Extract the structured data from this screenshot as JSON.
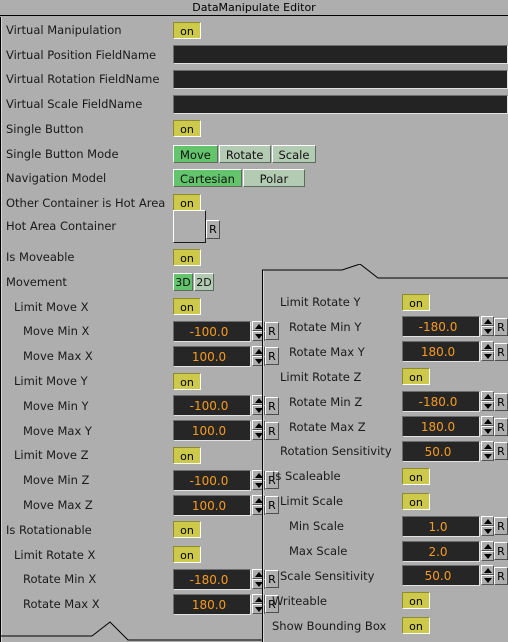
{
  "window": {
    "title": "DataManipulate Editor"
  },
  "colors": {
    "background": "#aeaeae",
    "toggle_on": "#cdc94a",
    "segment_selected": "#63c46c",
    "segment_unselected": "#b4cbb3",
    "field_background": "#262626",
    "field_text": "#f79b20"
  },
  "reset_label": "R",
  "left_column": {
    "rows": [
      {
        "label": "Virtual Manipulation",
        "type": "toggle",
        "value": "on",
        "indent": 0
      },
      {
        "label": "Virtual Position FieldName",
        "type": "text",
        "value": "",
        "indent": 0
      },
      {
        "label": "Virtual Rotation FieldName",
        "type": "text",
        "value": "",
        "indent": 0
      },
      {
        "label": "Virtual Scale FieldName",
        "type": "text",
        "value": "",
        "indent": 0
      },
      {
        "label": "Single Button",
        "type": "toggle",
        "value": "on",
        "indent": 0
      },
      {
        "label": "Single Button Mode",
        "type": "segments",
        "options": [
          "Move",
          "Rotate",
          "Scale"
        ],
        "selected": "Move",
        "indent": 0
      },
      {
        "label": "Navigation Model",
        "type": "segments",
        "options": [
          "Cartesian",
          "Polar"
        ],
        "selected": "Cartesian",
        "indent": 0
      },
      {
        "label": "Other Container is Hot Area",
        "type": "toggle",
        "value": "on",
        "indent": 0
      },
      {
        "label": "Hot Area Container",
        "type": "picker",
        "value": "",
        "indent": 0
      },
      {
        "label": "Is Moveable",
        "type": "toggle",
        "value": "on",
        "indent": 0
      },
      {
        "label": "Movement",
        "type": "segments",
        "options": [
          "3D",
          "2D"
        ],
        "selected": "3D",
        "indent": 0
      },
      {
        "label": "Limit Move X",
        "type": "toggle",
        "value": "on",
        "indent": 1
      },
      {
        "label": "Move Min X",
        "type": "number",
        "value": "-100.0",
        "indent": 2
      },
      {
        "label": "Move Max X",
        "type": "number",
        "value": "100.0",
        "indent": 2
      },
      {
        "label": "Limit Move Y",
        "type": "toggle",
        "value": "on",
        "indent": 1
      },
      {
        "label": "Move Min Y",
        "type": "number",
        "value": "-100.0",
        "indent": 2
      },
      {
        "label": "Move Max Y",
        "type": "number",
        "value": "100.0",
        "indent": 2
      },
      {
        "label": "Limit Move Z",
        "type": "toggle",
        "value": "on",
        "indent": 1
      },
      {
        "label": "Move Min Z",
        "type": "number",
        "value": "-100.0",
        "indent": 2
      },
      {
        "label": "Move Max Z",
        "type": "number",
        "value": "100.0",
        "indent": 2
      },
      {
        "label": "Is Rotationable",
        "type": "toggle",
        "value": "on",
        "indent": 0
      },
      {
        "label": "Limit Rotate X",
        "type": "toggle",
        "value": "on",
        "indent": 1
      },
      {
        "label": "Rotate Min X",
        "type": "number",
        "value": "-180.0",
        "indent": 2
      },
      {
        "label": "Rotate Max X",
        "type": "number",
        "value": "180.0",
        "indent": 2
      }
    ]
  },
  "right_column": {
    "rows": [
      {
        "label": "Limit Rotate Y",
        "type": "toggle",
        "value": "on",
        "indent": 1
      },
      {
        "label": "Rotate Min Y",
        "type": "number",
        "value": "-180.0",
        "indent": 2
      },
      {
        "label": "Rotate Max Y",
        "type": "number",
        "value": "180.0",
        "indent": 2
      },
      {
        "label": "Limit Rotate Z",
        "type": "toggle",
        "value": "on",
        "indent": 1
      },
      {
        "label": "Rotate Min Z",
        "type": "number",
        "value": "-180.0",
        "indent": 2
      },
      {
        "label": "Rotate Max Z",
        "type": "number",
        "value": "180.0",
        "indent": 2
      },
      {
        "label": "Rotation Sensitivity",
        "type": "number",
        "value": "50.0",
        "indent": 1
      },
      {
        "label": "Is Scaleable",
        "type": "toggle",
        "value": "on",
        "indent": 0
      },
      {
        "label": "Limit Scale",
        "type": "toggle",
        "value": "on",
        "indent": 1
      },
      {
        "label": "Min Scale",
        "type": "number",
        "value": "1.0",
        "indent": 2
      },
      {
        "label": "Max Scale",
        "type": "number",
        "value": "2.0",
        "indent": 2
      },
      {
        "label": "Scale Sensitivity",
        "type": "number",
        "value": "50.0",
        "indent": 1
      },
      {
        "label": "Writeable",
        "type": "toggle",
        "value": "on",
        "indent": 0
      },
      {
        "label": "Show Bounding Box",
        "type": "toggle",
        "value": "on",
        "indent": 0
      }
    ]
  }
}
